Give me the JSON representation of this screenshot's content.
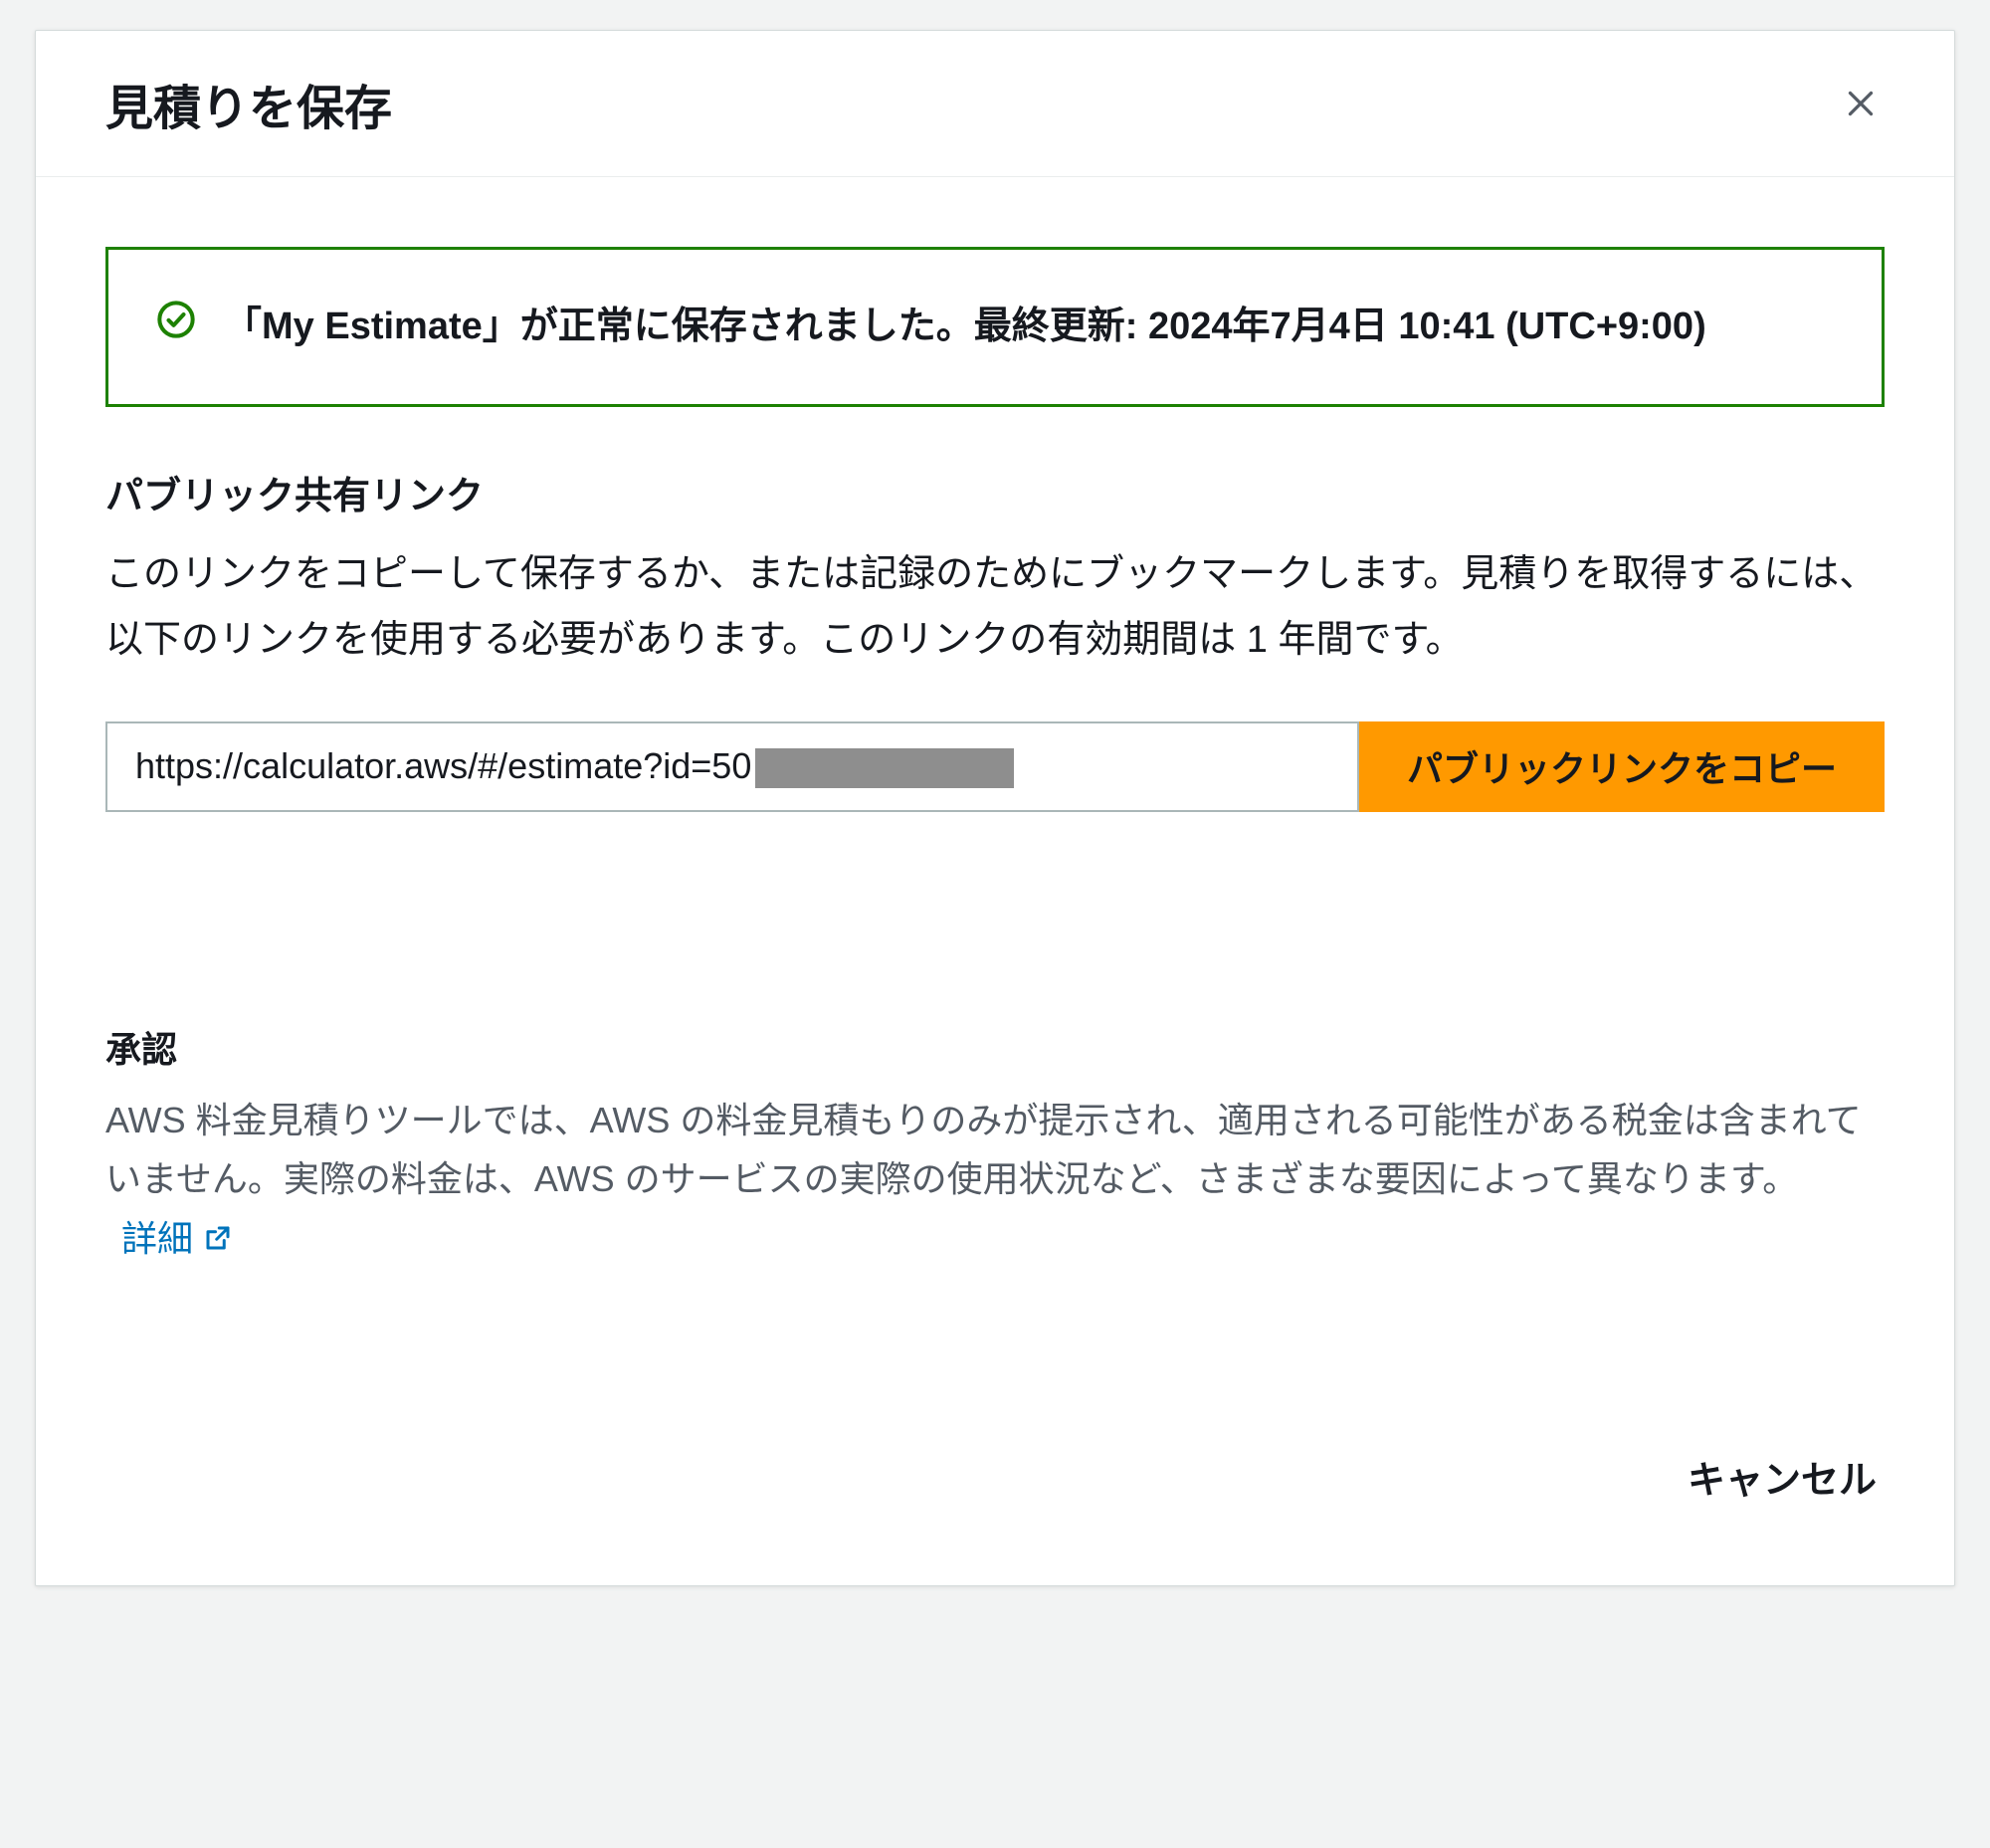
{
  "dialog": {
    "title": "見積りを保存",
    "alert": {
      "message": "「My Estimate」が正常に保存されました。最終更新: 2024年7月4日 10:41 (UTC+9:00)"
    },
    "share": {
      "heading": "パブリック共有リンク",
      "description": "このリンクをコピーして保存するか、または記録のためにブックマークします。見積りを取得するには、以下のリンクを使用する必要があります。このリンクの有効期間は 1 年間です。",
      "url_visible": "https://calculator.aws/#/estimate?id=50",
      "copy_label": "パブリックリンクをコピー"
    },
    "ack": {
      "heading": "承認",
      "text": "AWS 料金見積りツールでは、AWS の料金見積もりのみが提示され、適用される可能性がある税金は含まれていません。実際の料金は、AWS のサービスの実際の使用状況など、さまざまな要因によって異なります。",
      "detail_label": "詳細"
    },
    "footer": {
      "cancel_label": "キャンセル"
    }
  }
}
